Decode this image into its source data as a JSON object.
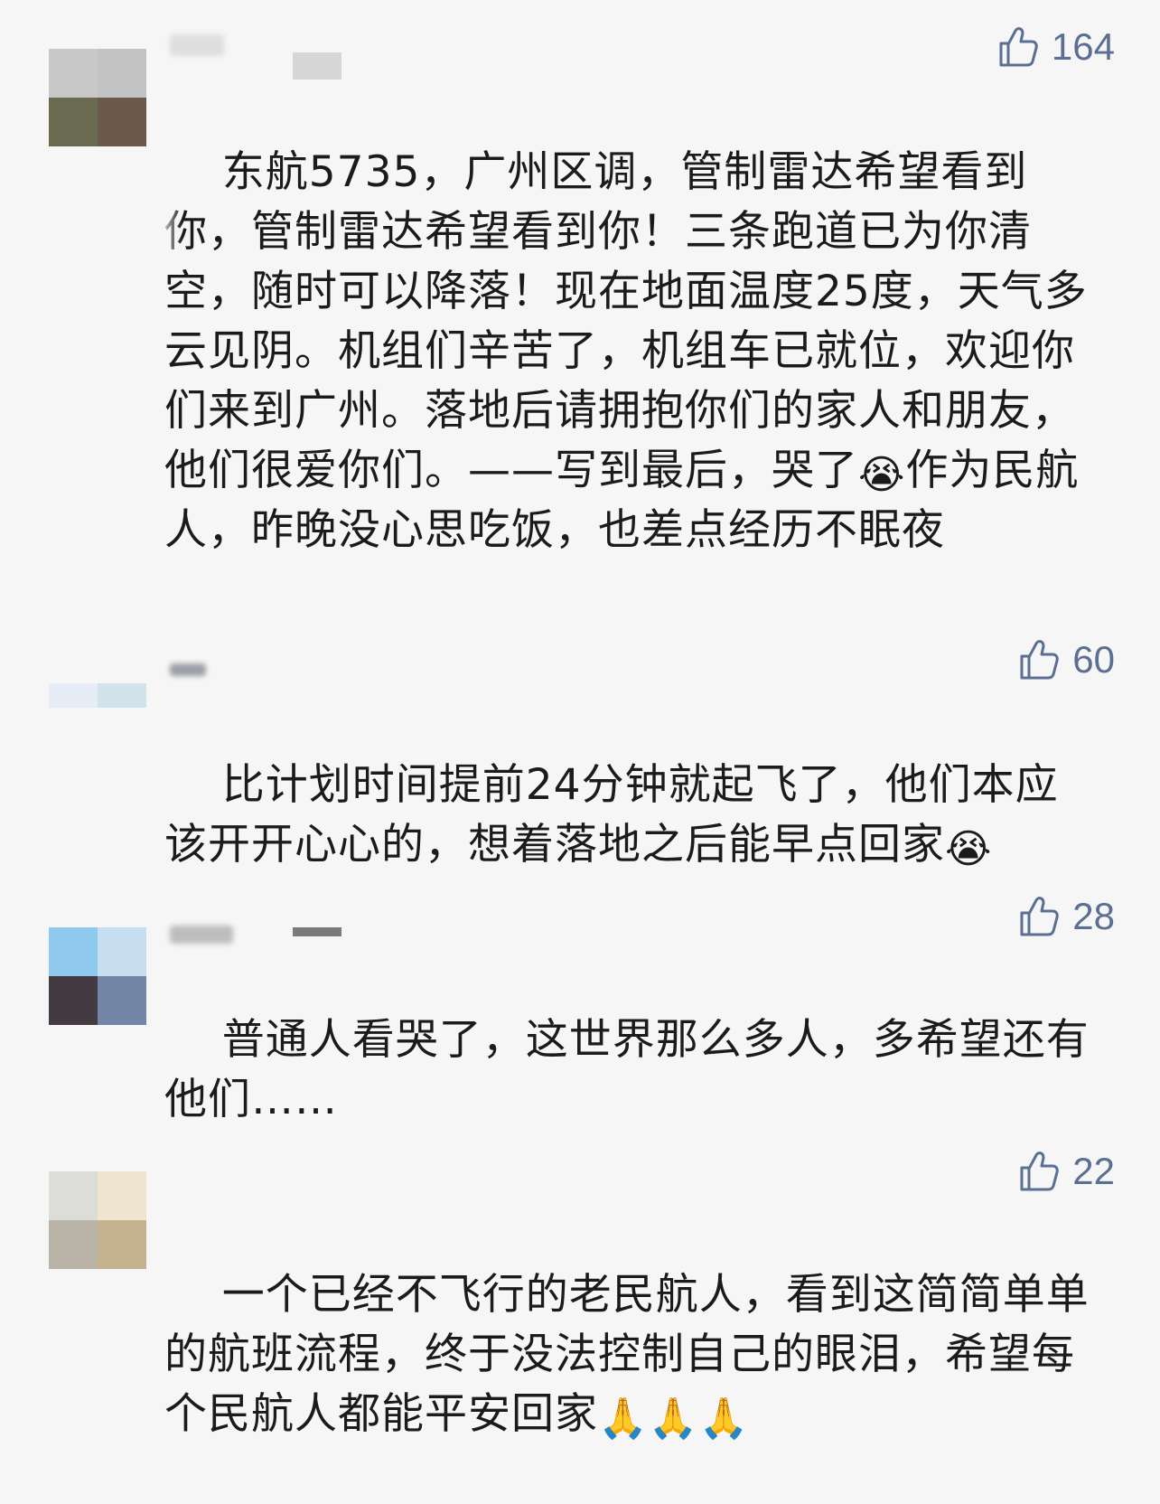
{
  "comments": [
    {
      "likes": "164",
      "text": "东航5735，广州区调，管制雷达希望看到你，管制雷达希望看到你！三条跑道已为你清空，随时可以降落！现在地面温度25度，天气多云见阴。机组们辛苦了，机组车已就位，欢迎你们来到广州。落地后请拥抱你们的家人和朋友，他们很爱你们。——写到最后，哭了",
      "text_tail": "作为民航人，昨晚没心思吃饭，也差点经历不眠夜",
      "emoji": "😭",
      "avatar_colors": [
        "#c8c8c8",
        "#c3c3c3",
        "#6a6a50",
        "#6b5a4b"
      ]
    },
    {
      "likes": "60",
      "text": "比计划时间提前24分钟就起飞了，他们本应该开开心心的，想着落地之后能早点回家",
      "emoji": "😭",
      "avatar_colors": [
        "#e7edf6",
        "#d3e3ec",
        "#f6f6f6",
        "#f6f6f6"
      ]
    },
    {
      "likes": "28",
      "text": "普通人看哭了，这世界那么多人，多希望还有他们……",
      "avatar_colors": [
        "#8fc9ee",
        "#c6def0",
        "#433a42",
        "#7486a8"
      ]
    },
    {
      "likes": "22",
      "text": "一个已经不飞行的老民航人，看到这简简单单的航班流程，终于没法控制自己的眼泪，希望每个民航人都能平安回家",
      "emoji_tail": "🙏🙏🙏",
      "avatar_colors": [
        "#dcdcd8",
        "#efe5cf",
        "#bab4a8",
        "#c4b38e"
      ]
    }
  ],
  "icons": {
    "like": "thumbs-up-icon",
    "crying": "loudly-crying-face-icon",
    "pray": "folded-hands-icon"
  },
  "colors": {
    "background": "#f6f6f6",
    "like_text": "#5b6f92",
    "comment_text": "#1b1b1b"
  }
}
